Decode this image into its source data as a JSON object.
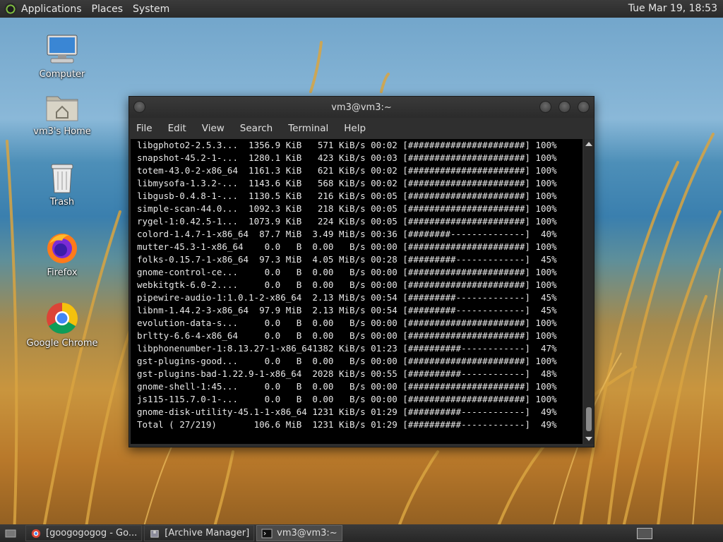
{
  "top_panel": {
    "menus": [
      "Applications",
      "Places",
      "System"
    ],
    "clock": "Tue Mar 19, 18:53"
  },
  "desktop": {
    "icons": [
      {
        "label": "Computer"
      },
      {
        "label": "vm3's Home"
      },
      {
        "label": "Trash"
      },
      {
        "label": "Firefox"
      },
      {
        "label": "Google Chrome"
      }
    ]
  },
  "terminal": {
    "title": "vm3@vm3:~",
    "menu": [
      "File",
      "Edit",
      "View",
      "Search",
      "Terminal",
      "Help"
    ],
    "lines": [
      "libgphoto2-2.5.3...  1356.9 KiB   571 KiB/s 00:02 [######################] 100%",
      "snapshot-45.2-1-...  1280.1 KiB   423 KiB/s 00:03 [######################] 100%",
      "totem-43.0-2-x86_64  1161.3 KiB   621 KiB/s 00:02 [######################] 100%",
      "libmysofa-1.3.2-...  1143.6 KiB   568 KiB/s 00:02 [######################] 100%",
      "libgusb-0.4.8-1-...  1130.5 KiB   216 KiB/s 00:05 [######################] 100%",
      "simple-scan-44.0...  1092.3 KiB   218 KiB/s 00:05 [######################] 100%",
      "rygel-1:0.42.5-1...  1073.9 KiB   224 KiB/s 00:05 [######################] 100%",
      "colord-1.4.7-1-x86_64  87.7 MiB  3.49 MiB/s 00:36 [########--------------]  40%",
      "mutter-45.3-1-x86_64    0.0   B  0.00   B/s 00:00 [######################] 100%",
      "folks-0.15.7-1-x86_64  97.3 MiB  4.05 MiB/s 00:28 [#########-------------]  45%",
      "gnome-control-ce...     0.0   B  0.00   B/s 00:00 [######################] 100%",
      "webkitgtk-6.0-2....     0.0   B  0.00   B/s 00:00 [######################] 100%",
      "pipewire-audio-1:1.0.1-2-x86_64  2.13 MiB/s 00:54 [#########-------------]  45%",
      "libnm-1.44.2-3-x86_64  97.9 MiB  2.13 MiB/s 00:54 [#########-------------]  45%",
      "evolution-data-s...     0.0   B  0.00   B/s 00:00 [######################] 100%",
      "brltty-6.6-4-x86_64     0.0   B  0.00   B/s 00:00 [######################] 100%",
      "libphonenumber-1:8.13.27-1-x86_641382 KiB/s 01:23 [##########------------]  47%",
      "gst-plugins-good...     0.0   B  0.00   B/s 00:00 [######################] 100%",
      "gst-plugins-bad-1.22.9-1-x86_64  2028 KiB/s 00:55 [##########------------]  48%",
      "gnome-shell-1:45...     0.0   B  0.00   B/s 00:00 [######################] 100%",
      "js115-115.7.0-1-...     0.0   B  0.00   B/s 00:00 [######################] 100%",
      "gnome-disk-utility-45.1-1-x86_64 1231 KiB/s 01:29 [##########------------]  49%",
      "Total ( 27/219)       106.6 MiB  1231 KiB/s 01:29 [##########------------]  49%"
    ]
  },
  "taskbar": {
    "tasks": [
      {
        "label": "[googogogog - Go..."
      },
      {
        "label": "[Archive Manager]"
      },
      {
        "label": "vm3@vm3:~"
      }
    ]
  },
  "colors": {
    "panel": "#2a2a2a",
    "terminal_bg": "#000000",
    "terminal_fg": "#e8e8e8"
  }
}
